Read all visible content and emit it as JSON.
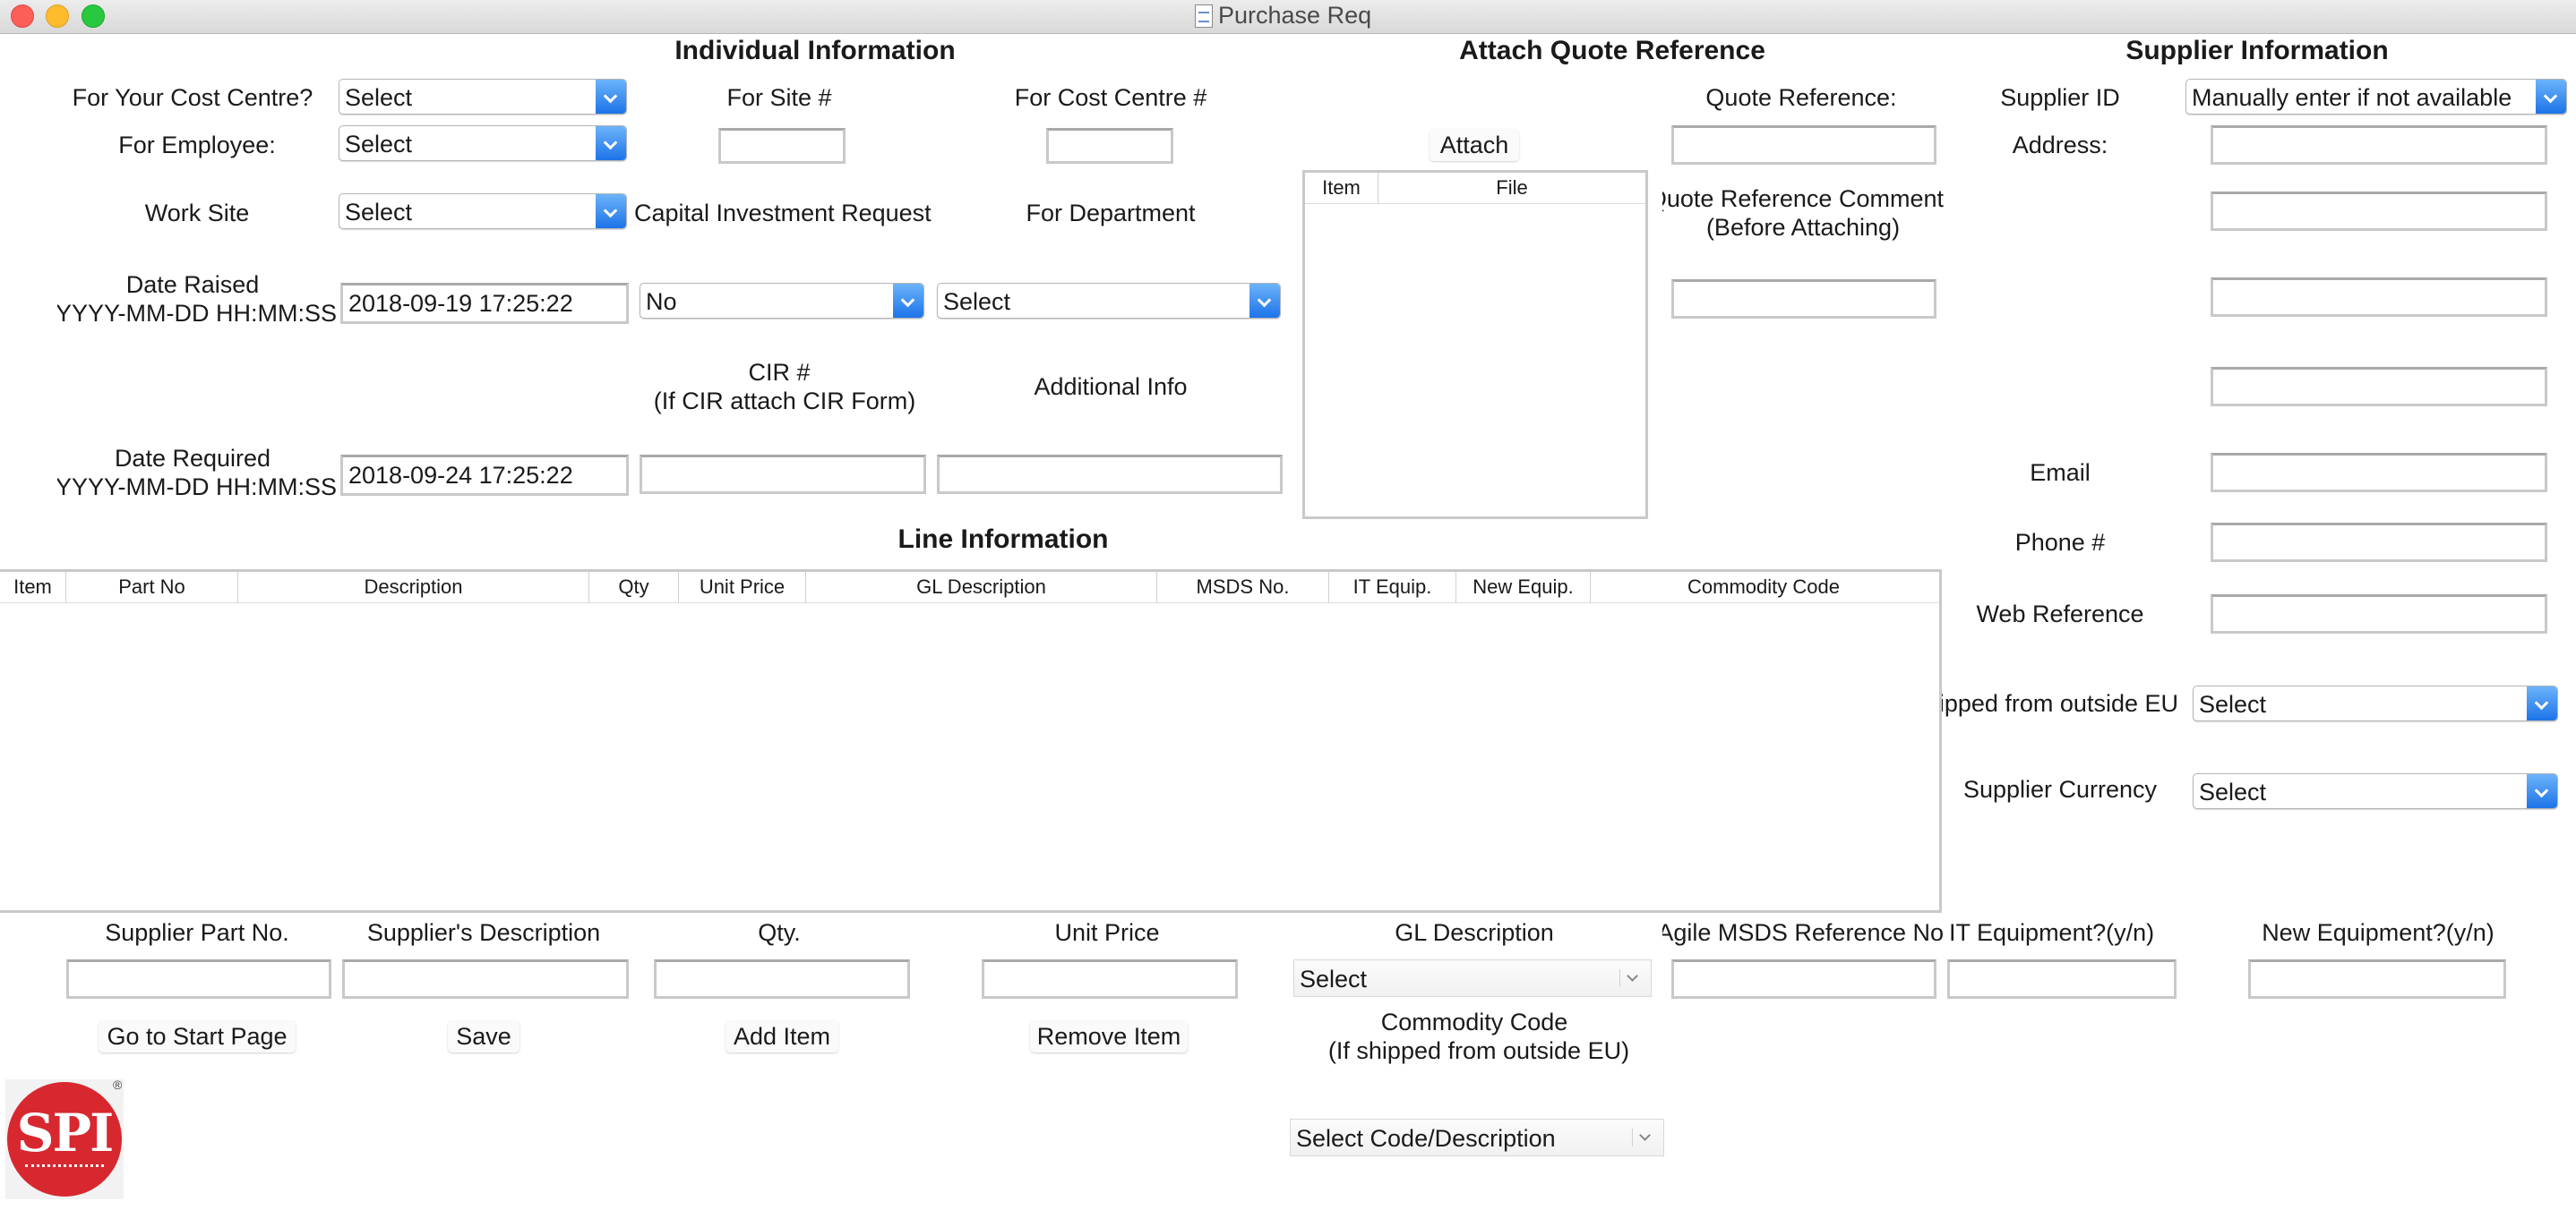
{
  "window": {
    "title": "Purchase Req"
  },
  "sections": {
    "individual": "Individual Information",
    "quote": "Attach Quote Reference",
    "supplier": "Supplier Information",
    "line": "Line Information"
  },
  "individual": {
    "cost_centre_q_label": "For Your Cost Centre?",
    "cost_centre_q_value": "Select",
    "employee_label": "For Employee:",
    "employee_value": "Select",
    "work_site_label": "Work Site",
    "work_site_value": "Select",
    "date_raised_label": "Date Raised",
    "date_raised_hint": "YYYY-MM-DD HH:MM:SS",
    "date_raised_value": "2018-09-19 17:25:22",
    "date_required_label": "Date Required",
    "date_required_hint": "YYYY-MM-DD HH:MM:SS",
    "date_required_value": "2018-09-24 17:25:22",
    "site_label": "For Site #",
    "site_value": "",
    "cost_centre_no_label": "For Cost Centre #",
    "cost_centre_no_value": "",
    "capital_label": "Capital Investment Request",
    "capital_value": "No",
    "department_label": "For Department",
    "department_value": "Select",
    "cir_label": "CIR #",
    "cir_hint": "(If CIR attach CIR Form)",
    "cir_value": "",
    "additional_label": "Additional Info",
    "additional_value": ""
  },
  "quote": {
    "attach_button": "Attach",
    "table_headers": [
      "Item",
      "File"
    ],
    "reference_label": "Quote Reference:",
    "reference_value": "",
    "comment_label": "Quote Reference Comment",
    "comment_hint": "(Before Attaching)",
    "comment_value": ""
  },
  "supplier": {
    "id_label": "Supplier ID",
    "id_value": "Manually enter if not available",
    "address_label": "Address:",
    "address_lines": [
      "",
      "",
      "",
      ""
    ],
    "email_label": "Email",
    "email_value": "",
    "phone_label": "Phone #",
    "phone_value": "",
    "web_label": "Web Reference",
    "web_value": "",
    "shipped_label": "Shipped from outside EU",
    "shipped_value": "Select",
    "currency_label": "Supplier Currency",
    "currency_value": "Select"
  },
  "line": {
    "table_headers": [
      "Item",
      "Part No",
      "Description",
      "Qty",
      "Unit Price",
      "GL Description",
      "MSDS No.",
      "IT Equip.",
      "New Equip.",
      "Commodity Code"
    ]
  },
  "entry": {
    "part_no_label": "Supplier Part No.",
    "description_label": "Supplier's Description",
    "qty_label": "Qty.",
    "unit_price_label": "Unit Price",
    "gl_label": "GL Description",
    "gl_value": "Select",
    "msds_label": "Agile MSDS Reference No.",
    "it_label": "IT Equipment?(y/n)",
    "new_label": "New Equipment?(y/n)",
    "commodity_label": "Commodity Code",
    "commodity_hint": "(If shipped from outside EU)",
    "commodity_value": "Select Code/Description"
  },
  "buttons": {
    "start": "Go to Start Page",
    "save": "Save",
    "add": "Add Item",
    "remove": "Remove Item"
  },
  "logo": {
    "text": "SPI"
  },
  "colors": {
    "combo_arrow": "#1d74e8",
    "logo_red": "#d7282f"
  }
}
